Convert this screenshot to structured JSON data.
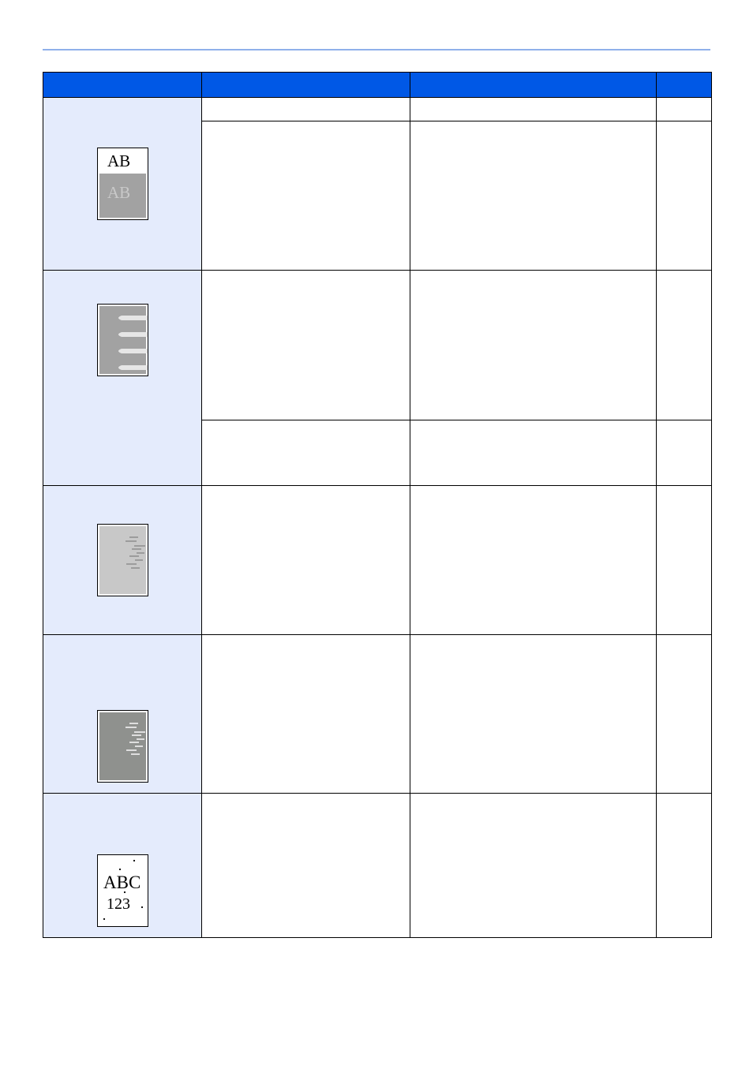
{
  "colors": {
    "header_bg": "#0058e6",
    "symptom_bg": "#e4ebfc",
    "rule": "#8fb0ea"
  },
  "table": {
    "headers": [
      "",
      "",
      "",
      ""
    ],
    "rows": [
      {
        "symptom_image": "ab-image-icon",
        "image_text_top": "AB",
        "image_text_bottom": "AB",
        "checkpoints": [
          "",
          ""
        ],
        "actions": [
          "",
          ""
        ],
        "pages": [
          "",
          ""
        ]
      },
      {
        "symptom_image": "white-streaks-image-icon",
        "checkpoints": [
          "",
          ""
        ],
        "actions": [
          "",
          ""
        ],
        "pages": [
          "",
          ""
        ]
      },
      {
        "symptom_image": "gray-dashes-image-icon",
        "checkpoints": [
          ""
        ],
        "actions": [
          ""
        ],
        "pages": [
          ""
        ]
      },
      {
        "symptom_image": "white-dashes-image-icon",
        "checkpoints": [
          ""
        ],
        "actions": [
          ""
        ],
        "pages": [
          ""
        ]
      },
      {
        "symptom_image": "dots-image-icon",
        "image_text_top": "ABC",
        "image_text_bottom": "123",
        "checkpoints": [
          ""
        ],
        "actions": [
          ""
        ],
        "pages": [
          ""
        ]
      }
    ]
  }
}
